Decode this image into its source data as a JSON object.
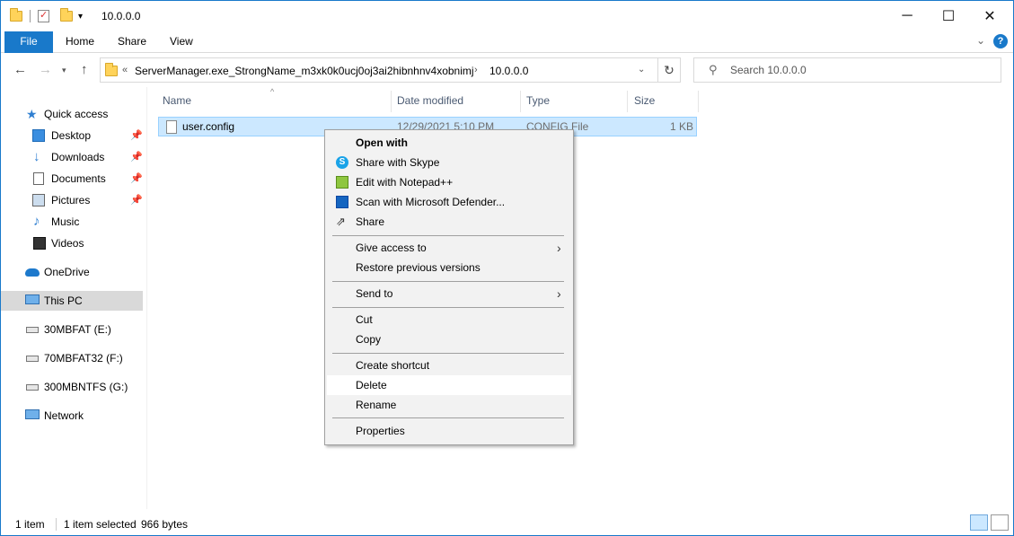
{
  "titlebar": {
    "title": "10.0.0.0",
    "minimize": "─",
    "maximize": "☐",
    "close": "✕"
  },
  "ribbon": {
    "tabs": [
      "File",
      "Home",
      "Share",
      "View"
    ],
    "collapse_icon": "chevron-down-icon",
    "help": "?"
  },
  "address": {
    "overflow": "«",
    "segments": [
      "ServerManager.exe_StrongName_m3xk0k0ucj0oj3ai2hibnhnv4xobnimj",
      "10.0.0.0"
    ],
    "separator": "›"
  },
  "search": {
    "placeholder": "Search 10.0.0.0"
  },
  "navpane": {
    "quick_access": "Quick access",
    "desktop": "Desktop",
    "downloads": "Downloads",
    "documents": "Documents",
    "pictures": "Pictures",
    "music": "Music",
    "videos": "Videos",
    "onedrive": "OneDrive",
    "this_pc": "This PC",
    "drive_e": "30MBFAT (E:)",
    "drive_f": "70MBFAT32 (F:)",
    "drive_g": "300MBNTFS (G:)",
    "network": "Network"
  },
  "columns": {
    "name": "Name",
    "date": "Date modified",
    "type": "Type",
    "size": "Size"
  },
  "file": {
    "name": "user.config",
    "date": "12/29/2021 5:10 PM",
    "type": "CONFIG File",
    "size": "1 KB"
  },
  "context_menu": {
    "open_with": "Open with",
    "share_skype": "Share with Skype",
    "edit_npp": "Edit with Notepad++",
    "scan_defender": "Scan with Microsoft Defender...",
    "share": "Share",
    "give_access": "Give access to",
    "restore": "Restore previous versions",
    "send_to": "Send to",
    "cut": "Cut",
    "copy": "Copy",
    "create_shortcut": "Create shortcut",
    "delete": "Delete",
    "rename": "Rename",
    "properties": "Properties"
  },
  "status": {
    "count": "1 item",
    "selected": "1 item selected",
    "size": "966 bytes"
  },
  "colors": {
    "accent": "#1979ca",
    "selection": "#cce8ff",
    "menu_bg": "#f2f2f2"
  }
}
